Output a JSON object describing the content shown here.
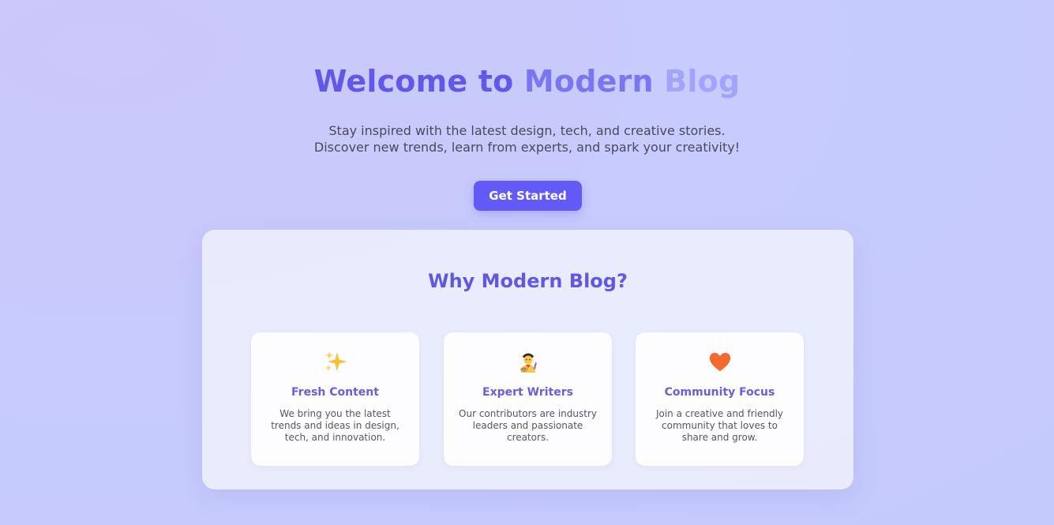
{
  "hero": {
    "title_part1": "Welcome to ",
    "title_part2": "Modern ",
    "title_part3": "Blog",
    "subtitle_line1": "Stay inspired with the latest design, tech, and creative stories.",
    "subtitle_line2": "Discover new trends, learn from experts, and spark your creativity!",
    "cta_label": "Get Started"
  },
  "features": {
    "title": "Why Modern Blog?",
    "cards": [
      {
        "icon": "sparkles-icon",
        "title": "Fresh Content",
        "text": "We bring you the latest trends and ideas in design, tech, and innovation."
      },
      {
        "icon": "artist-icon",
        "title": "Expert Writers",
        "text": "Our contributors are industry leaders and passionate creators."
      },
      {
        "icon": "heart-icon",
        "title": "Community Focus",
        "text": "Join a creative and friendly community that loves to share and grow."
      }
    ]
  },
  "colors": {
    "accent": "#6359f7",
    "heading": "#6158e2",
    "heart": "#f26a2e",
    "sparkle": "#f7c23a"
  }
}
